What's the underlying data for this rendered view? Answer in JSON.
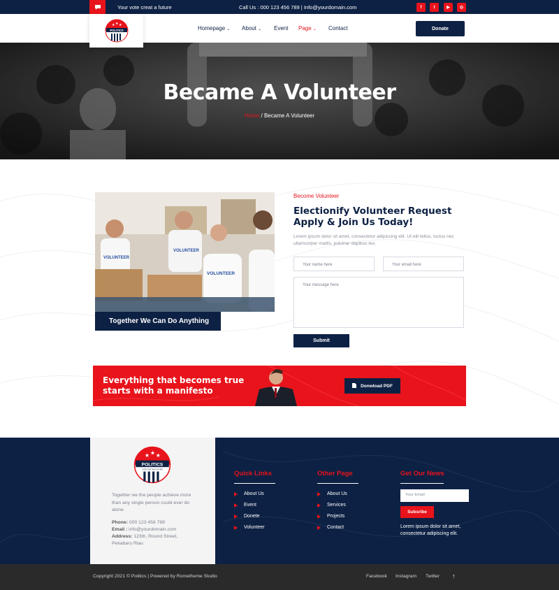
{
  "topbar": {
    "tagline": "Your vote creat a future",
    "contact": "Call Us : 000 123 456 789 | Info@yourdomain.com",
    "social": [
      {
        "icon": "facebook-icon",
        "glyph": "f"
      },
      {
        "icon": "twitter-icon",
        "glyph": "t"
      },
      {
        "icon": "youtube-icon",
        "glyph": "▶"
      },
      {
        "icon": "instagram-icon",
        "glyph": "◎"
      }
    ]
  },
  "logo": {
    "text": "POLITICS",
    "sub": "VOTE FOR THE FUTURE"
  },
  "nav": {
    "items": [
      {
        "label": "Homepage",
        "has_caret": true
      },
      {
        "label": "About",
        "has_caret": true
      },
      {
        "label": "Event",
        "has_caret": false
      },
      {
        "label": "Page",
        "has_caret": true
      },
      {
        "label": "Contact",
        "has_caret": false
      }
    ],
    "caret": "⌄",
    "donate_label": "Donate"
  },
  "hero": {
    "title": "Became A Volunteer",
    "breadcrumb_home": "Home",
    "breadcrumb_sep": " / ",
    "breadcrumb_current": "Became A Volunteer"
  },
  "volunteer": {
    "photo_caption": "Together We Can Do Anything",
    "shirt_text": "VOLUNTEER",
    "eyebrow": "Become Volunteer",
    "heading_line1": "Electionify Volunteer Request",
    "heading_line2": "Apply & Join Us Today!",
    "lead": "Lorem ipsum dolor sit amet, consectetur adipiscing elit. Ut elit tellus, luctus nec ullamcorper mattis, pulvinar dapibus leo.",
    "name_placeholder": "Your name here",
    "email_placeholder": "Your email here",
    "message_placeholder": "Your message here",
    "submit_label": "Submit"
  },
  "banner": {
    "line1": "Everything that becomes true",
    "line2": "starts with a manifesto",
    "button_label": "Donwload PDF"
  },
  "footer": {
    "about": "Together we the people achieve more than any single person could ever do alone.",
    "phone_label": "Phone:",
    "phone": " 000 123 456 789",
    "email_label": "Email :",
    "email": " info@yourdomain.com",
    "address_label": "Address:",
    "address": " 123th, Round Street,",
    "address2": "Pekabaru Riau",
    "quick_links_title": "Quick Links",
    "quick_links": [
      "About Us",
      "Event",
      "Donete",
      "Volunteer"
    ],
    "other_page_title": "Other Page",
    "other_pages": [
      "About Us",
      "Services",
      "Projects",
      "Contact"
    ],
    "news_title": "Get Our News",
    "news_placeholder": "Your Email",
    "subscribe_label": "Subsribe",
    "news_text": "Lorem ipsum dolor sit amet, consectetur adipiscing elit."
  },
  "bottom": {
    "copyright": "Copyright 2021 © Politics | Powered by Rometheme Studio",
    "links": [
      "Facebook",
      "Instagram",
      "Twitter"
    ],
    "top_arrow": "↑"
  },
  "colors": {
    "navy": "#0d2144",
    "red": "#e8131b",
    "dark": "#2a2a2a"
  }
}
